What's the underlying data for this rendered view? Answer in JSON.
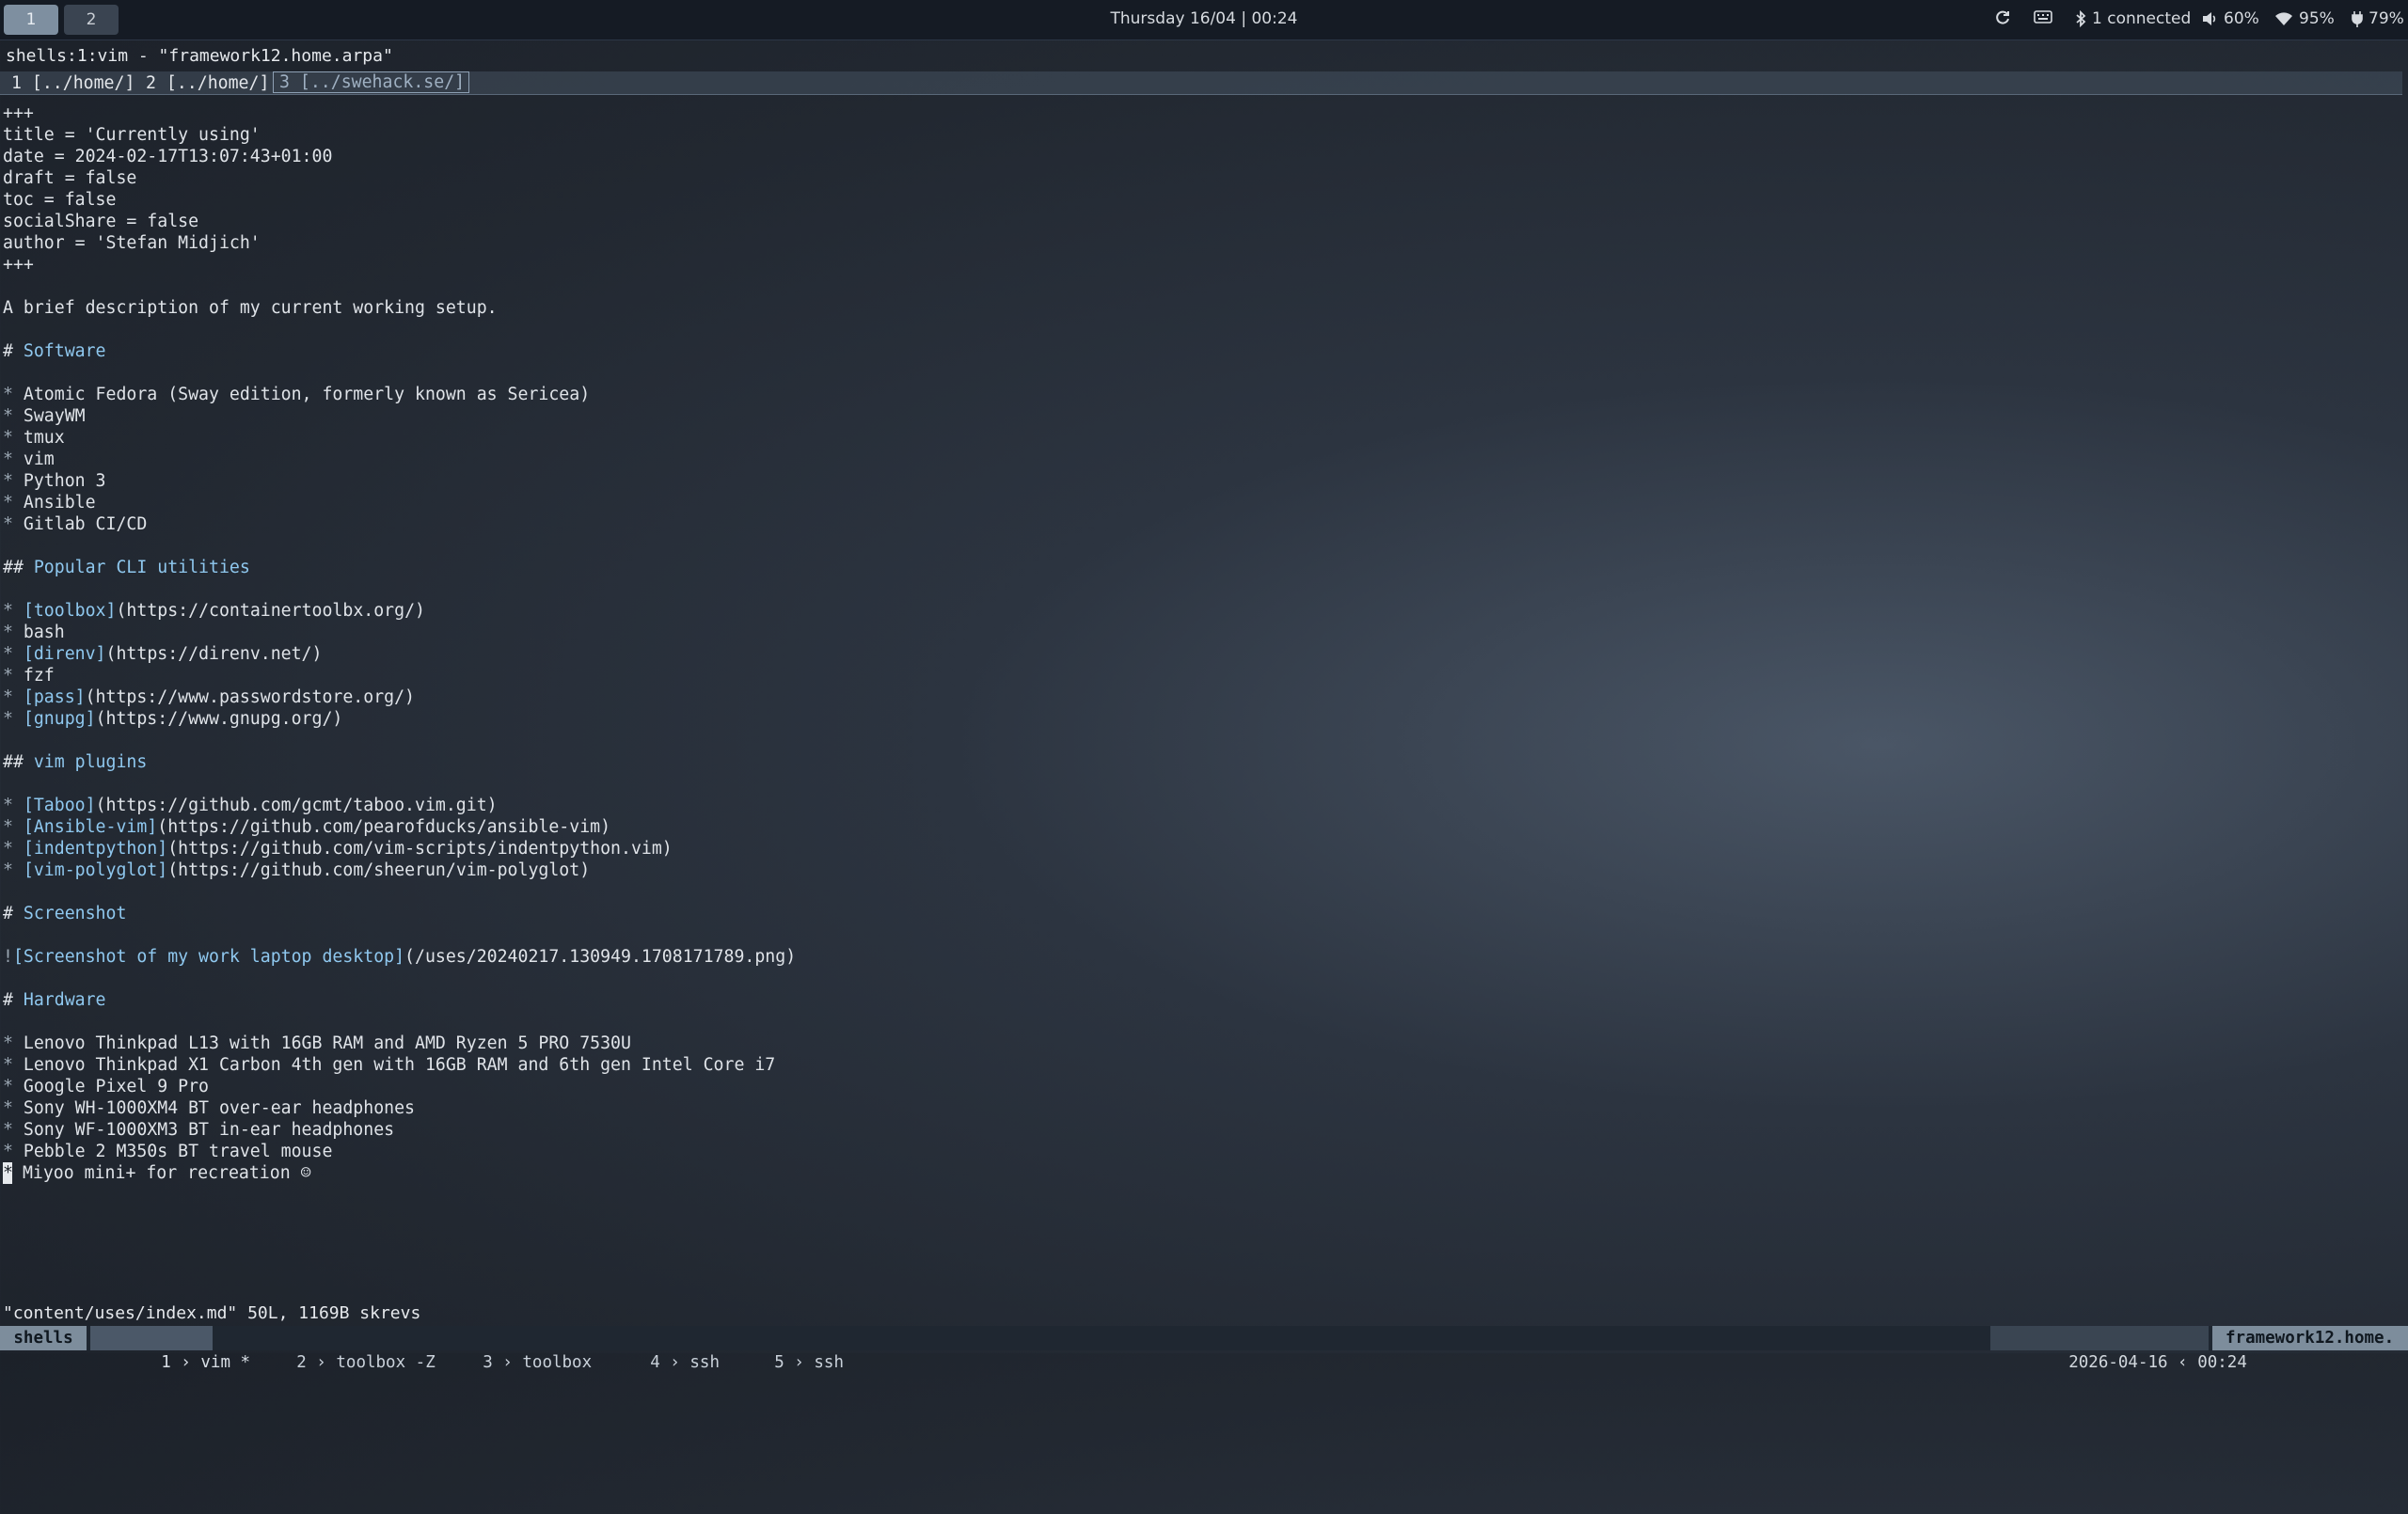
{
  "topbar": {
    "workspaces": [
      "1",
      "2"
    ],
    "clock": "Thursday 16/04 | 00:24",
    "bluetooth": "1 connected",
    "volume": "60%",
    "wifi": "95%",
    "battery": "79%"
  },
  "tmux": {
    "pane_title": "shells:1:vim - \"framework12.home.arpa\""
  },
  "vim": {
    "tabs": [
      {
        "label": "1 [../home/]"
      },
      {
        "label": "2 [../home/]"
      },
      {
        "label": "3 [../swehack.se/]"
      }
    ],
    "lines": [
      "+++",
      "title = 'Currently using'",
      "date = 2024-02-17T13:07:43+01:00",
      "draft = false",
      "toc = false",
      "socialShare = false",
      "author = 'Stefan Midjich'",
      "+++",
      "",
      "A brief description of my current working setup.",
      "",
      "# Software",
      "",
      "* Atomic Fedora (Sway edition, formerly known as Sericea)",
      "* SwayWM",
      "* tmux",
      "* vim",
      "* Python 3",
      "* Ansible",
      "* Gitlab CI/CD",
      "",
      "## Popular CLI utilities",
      "",
      "* [toolbox](https://containertoolbx.org/)",
      "* bash",
      "* [direnv](https://direnv.net/)",
      "* fzf",
      "* [pass](https://www.passwordstore.org/)",
      "* [gnupg](https://www.gnupg.org/)",
      "",
      "## vim plugins",
      "",
      "* [Taboo](https://github.com/gcmt/taboo.vim.git)",
      "* [Ansible-vim](https://github.com/pearofducks/ansible-vim)",
      "* [indentpython](https://github.com/vim-scripts/indentpython.vim)",
      "* [vim-polyglot](https://github.com/sheerun/vim-polyglot)",
      "",
      "# Screenshot",
      "",
      "![Screenshot of my work laptop desktop](/uses/20240217.130949.1708171789.png)",
      "",
      "# Hardware",
      "",
      "* Lenovo Thinkpad L13 with 16GB RAM and AMD Ryzen 5 PRO 7530U",
      "* Lenovo Thinkpad X1 Carbon 4th gen with 16GB RAM and 6th gen Intel Core i7",
      "* Google Pixel 9 Pro",
      "* Sony WH-1000XM4 BT over-ear headphones",
      "* Sony WF-1000XM3 BT in-ear headphones",
      "* Pebble 2 M350s BT travel mouse",
      "* Miyoo mini+ for recreation ☺"
    ],
    "message": "\"content/uses/index.md\" 50L, 1169B skrevs"
  },
  "status": {
    "session": "shells",
    "windows": [
      {
        "index": "1",
        "name": "vim *"
      },
      {
        "index": "2",
        "name": "toolbox -Z"
      },
      {
        "index": "3",
        "name": "toolbox"
      },
      {
        "index": "4",
        "name": "ssh"
      },
      {
        "index": "5",
        "name": "ssh"
      }
    ],
    "date": "2026-04-16",
    "time": "00:24",
    "host": "framework12.home."
  }
}
